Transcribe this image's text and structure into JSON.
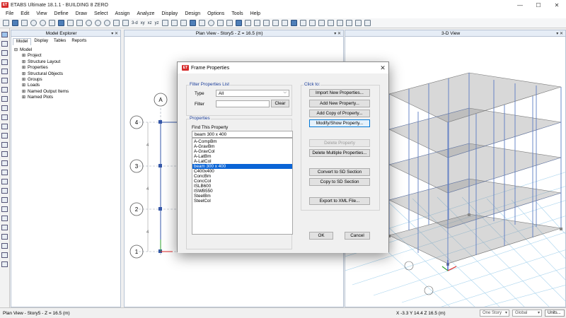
{
  "app": {
    "title": "ETABS Ultimate 18.1.1 - BUILDING 8 ZERO",
    "icon_text": "ET",
    "window_buttons": [
      "—",
      "☐",
      "✕"
    ]
  },
  "menu": [
    "File",
    "Edit",
    "View",
    "Define",
    "Draw",
    "Select",
    "Assign",
    "Analyze",
    "Display",
    "Design",
    "Options",
    "Tools",
    "Help"
  ],
  "toolbar": {
    "text_3d": "3-d",
    "text_xy": "xy",
    "text_xz": "xz",
    "text_yz": "yz"
  },
  "explorer": {
    "title": "Model Explorer",
    "buttons": "▾ ✕",
    "tabs": [
      "Model",
      "Display",
      "Tables",
      "Reports"
    ],
    "active_tab": "Model",
    "tree": [
      {
        "label": "Model",
        "sign": "⊟",
        "level": 0
      },
      {
        "label": "Project",
        "sign": "⊞",
        "level": 1
      },
      {
        "label": "Structure Layout",
        "sign": "⊞",
        "level": 1
      },
      {
        "label": "Properties",
        "sign": "⊞",
        "level": 1
      },
      {
        "label": "Structural Objects",
        "sign": "⊞",
        "level": 1
      },
      {
        "label": "Groups",
        "sign": "⊞",
        "level": 1
      },
      {
        "label": "Loads",
        "sign": "⊞",
        "level": 1
      },
      {
        "label": "Named Output Items",
        "sign": "⊞",
        "level": 1
      },
      {
        "label": "Named Plots",
        "sign": "⊞",
        "level": 1
      }
    ]
  },
  "plan_view": {
    "title": "Plan View - Story5 - Z = 16.5 (m)",
    "buttons": "▾ ✕",
    "grid_col": "A",
    "grid_rows": [
      "4",
      "3",
      "2",
      "1"
    ],
    "dimension_label": "4"
  },
  "view_3d": {
    "title": "3-D View",
    "buttons": "▾ ✕"
  },
  "dialog": {
    "title": "Frame Properties",
    "icon_text": "ET",
    "close": "✕",
    "filter_group": "Filter Properties List",
    "type_label": "Type",
    "type_value": "All",
    "filter_label": "Filter",
    "filter_value": "",
    "clear_button": "Clear",
    "properties_group": "Properties",
    "find_label": "Find This Property",
    "find_value": "beam 300 x 400",
    "properties": [
      "A-CompBm",
      "A-GravBm",
      "A-GravCol",
      "A-LatBm",
      "A-LatCol",
      "beam 300 x 400",
      "C400x400",
      "ConcBm",
      "ConcCol",
      "ISLB600",
      "ISWB550",
      "SteelBm",
      "SteelCol"
    ],
    "selected_property": "beam 300 x 400",
    "click_to_group": "Click to:",
    "buttons": {
      "import": "Import New Properties...",
      "add_new": "Add New Property...",
      "add_copy": "Add Copy of Property...",
      "modify": "Modify/Show Property...",
      "delete": "Delete Property",
      "delete_multiple": "Delete Multiple Properties...",
      "convert_sd": "Convert to SD Section",
      "copy_sd": "Copy to SD Section",
      "export_xml": "Export to XML File...",
      "ok": "OK",
      "cancel": "Cancel"
    }
  },
  "status": {
    "left": "Plan View - Story5 - Z = 16.5 (m)",
    "coords": "X -3.3  Y 14.4  Z 16.5 (m)",
    "story_mode": "One Story",
    "coord_system": "Global",
    "units": "Units..."
  },
  "colors": {
    "accent": "#0a64d6",
    "grid_blue": "#3557a8",
    "frame_blue": "#5b7cc4",
    "slab_gray": "#9a9a9a",
    "icon_red": "#d62c2c"
  }
}
